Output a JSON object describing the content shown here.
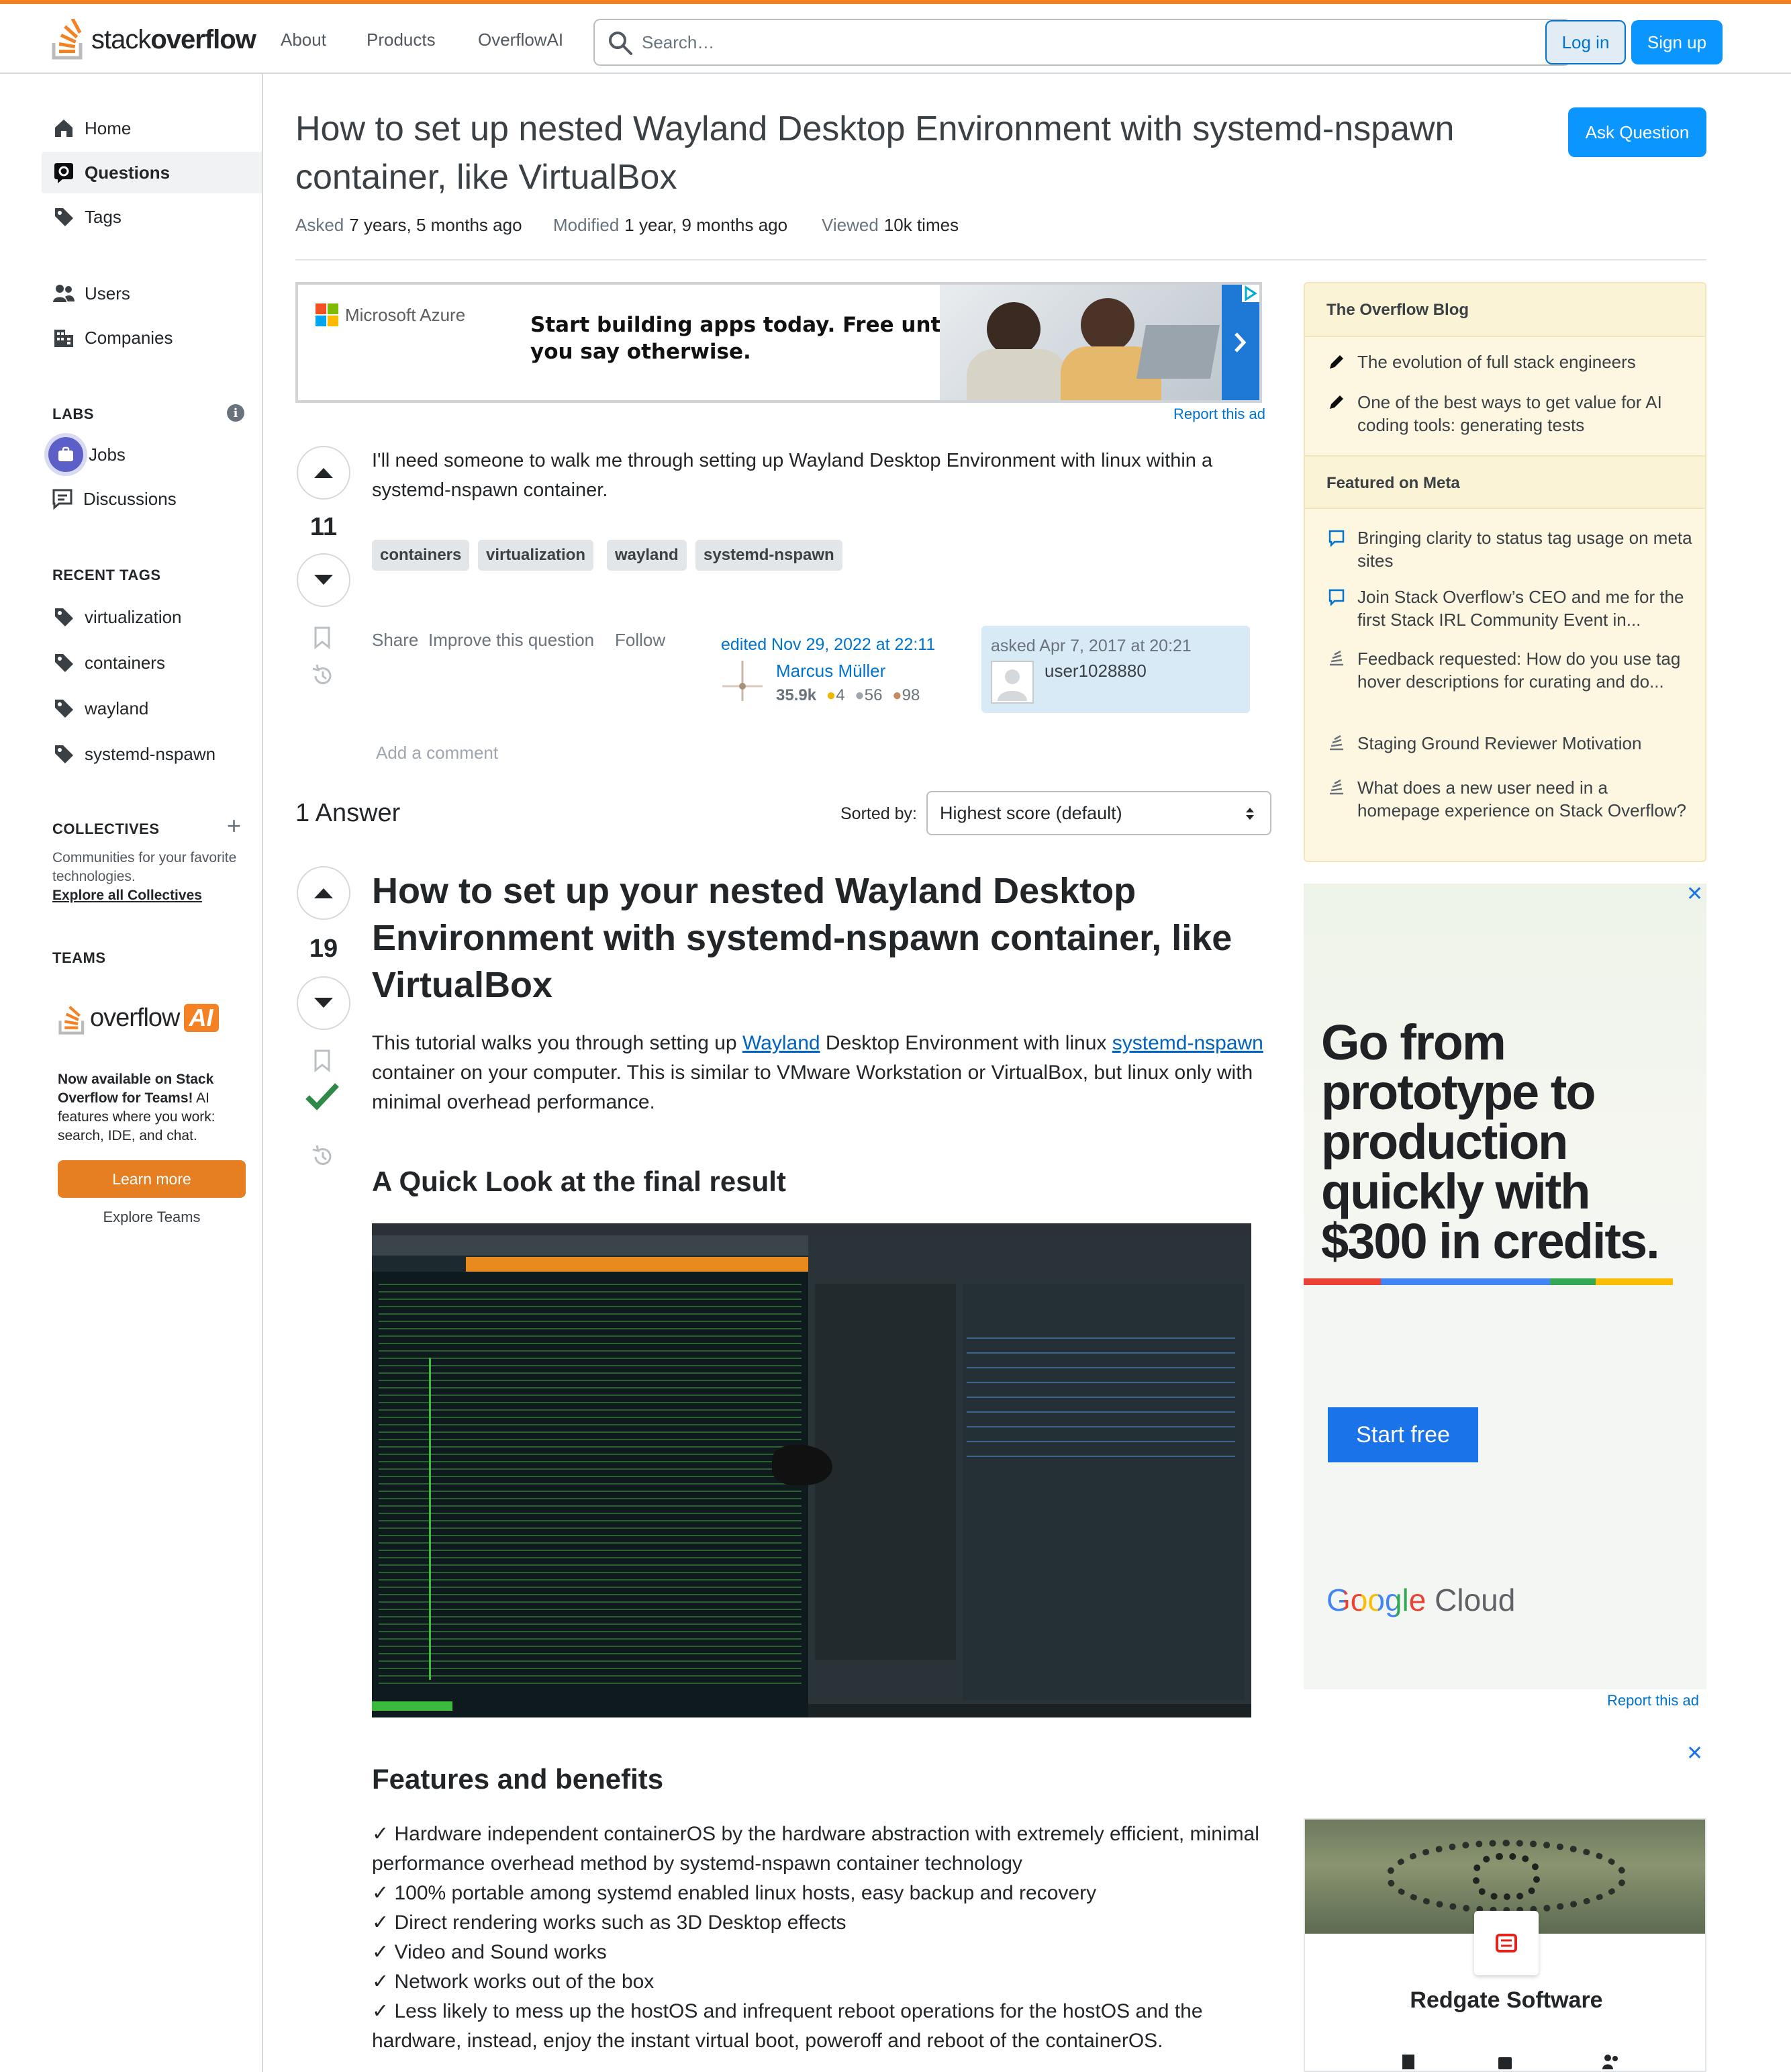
{
  "header": {
    "logo_text_light": "stack",
    "logo_text_bold": "overflow",
    "nav": [
      "About",
      "Products",
      "OverflowAI"
    ],
    "search_placeholder": "Search…",
    "login_label": "Log in",
    "signup_label": "Sign up",
    "accent_color": "#f48225"
  },
  "sidebar": {
    "main_items": [
      {
        "label": "Home",
        "icon": "home-icon"
      },
      {
        "label": "Questions",
        "icon": "questions-icon",
        "active": true
      },
      {
        "label": "Tags",
        "icon": "tag-icon"
      }
    ],
    "people_items": [
      {
        "label": "Users",
        "icon": "users-icon"
      },
      {
        "label": "Companies",
        "icon": "companies-icon"
      }
    ],
    "labs_heading": "LABS",
    "labs_items": [
      {
        "label": "Jobs",
        "icon": "jobs-icon"
      },
      {
        "label": "Discussions",
        "icon": "discussions-icon"
      }
    ],
    "recent_tags_heading": "RECENT TAGS",
    "recent_tags": [
      "virtualization",
      "containers",
      "wayland",
      "systemd-nspawn"
    ],
    "collectives_heading": "COLLECTIVES",
    "collectives_desc": "Communities for your favorite technologies.",
    "collectives_link": "Explore all Collectives",
    "teams_heading": "TEAMS",
    "teams_logo_text": "overflow",
    "teams_logo_badge": "AI",
    "teams_desc_bold": "Now available on Stack Overflow for Teams!",
    "teams_desc": " AI features where you work: search, IDE, and chat.",
    "learn_more_label": "Learn more",
    "explore_teams_label": "Explore Teams"
  },
  "question": {
    "title": "How to set up nested Wayland Desktop Environment with systemd-nspawn container, like VirtualBox",
    "ask_label": "Ask Question",
    "asked_label": "Asked",
    "asked_value": "7 years, 5 months ago",
    "modified_label": "Modified",
    "modified_value": "1 year, 9 months ago",
    "viewed_label": "Viewed",
    "viewed_value": "10k times",
    "score": "11",
    "body": "I'll need someone to walk me through setting up Wayland Desktop Environment with linux within a systemd-nspawn container.",
    "tags": [
      "containers",
      "virtualization",
      "wayland",
      "systemd-nspawn"
    ],
    "menu": [
      "Share",
      "Improve this question",
      "Follow"
    ],
    "edited_label": "edited Nov 29, 2022 at 22:11",
    "editor_name": "Marcus Müller",
    "editor_rep": "35.9k",
    "editor_gold": "4",
    "editor_silver": "56",
    "editor_bronze": "98",
    "asked_full": "asked Apr 7, 2017 at 20:21",
    "asker_name": "user1028880",
    "add_comment": "Add a comment"
  },
  "ad_top": {
    "brand": "Microsoft Azure",
    "text_line1": "Start building apps today. Free until",
    "text_line2": "you say otherwise.",
    "report": "Report this ad"
  },
  "answers": {
    "heading": "1 Answer",
    "sorted_label": "Sorted by:",
    "sorted_value": "Highest score (default)",
    "score": "19",
    "h1": "How to set up your nested Wayland Desktop Environment with systemd-nspawn container, like VirtualBox",
    "intro_1": "This tutorial walks you through setting up ",
    "intro_link1": "Wayland",
    "intro_2": " Desktop Environment with linux ",
    "intro_link2": "systemd-nspawn",
    "intro_3": " container on your computer. This is similar to VMware Workstation or VirtualBox, but linux only with minimal overhead performance.",
    "h2_quick": "A Quick Look at the final result",
    "h2_features": "Features and benefits",
    "features": [
      "✓ Hardware independent containerOS by the hardware abstraction with extremely efficient, minimal performance overhead method by systemd-nspawn container technology",
      "✓ 100% portable among systemd enabled linux hosts, easy backup and recovery",
      "✓ Direct rendering works such as 3D Desktop effects",
      "✓ Video and Sound works",
      "✓ Network works out of the box",
      "✓ Less likely to mess up the hostOS and infrequent reboot operations for the hostOS and the hardware, instead, enjoy the instant virtual boot, poweroff and reboot of the containerOS."
    ]
  },
  "blog": {
    "heading": "The Overflow Blog",
    "items": [
      "The evolution of full stack engineers",
      "One of the best ways to get value for AI coding tools: generating tests"
    ],
    "meta_heading": "Featured on Meta",
    "meta_items": [
      "Bringing clarity to status tag usage on meta sites",
      "Join Stack Overflow’s CEO and me for the first Stack IRL Community Event in...",
      "Feedback requested: How do you use tag hover descriptions for curating and do...",
      "Staging Ground Reviewer Motivation",
      "What does a new user need in a homepage experience on Stack Overflow?"
    ]
  },
  "ad_google": {
    "headline": "Go from prototype to production quickly with $300 in credits.",
    "button": "Start free",
    "brand_google": "Google",
    "brand_cloud": " Cloud",
    "report": "Report this ad",
    "close": "✕"
  },
  "ad_redgate": {
    "name": "Redgate Software",
    "close": "✕"
  }
}
